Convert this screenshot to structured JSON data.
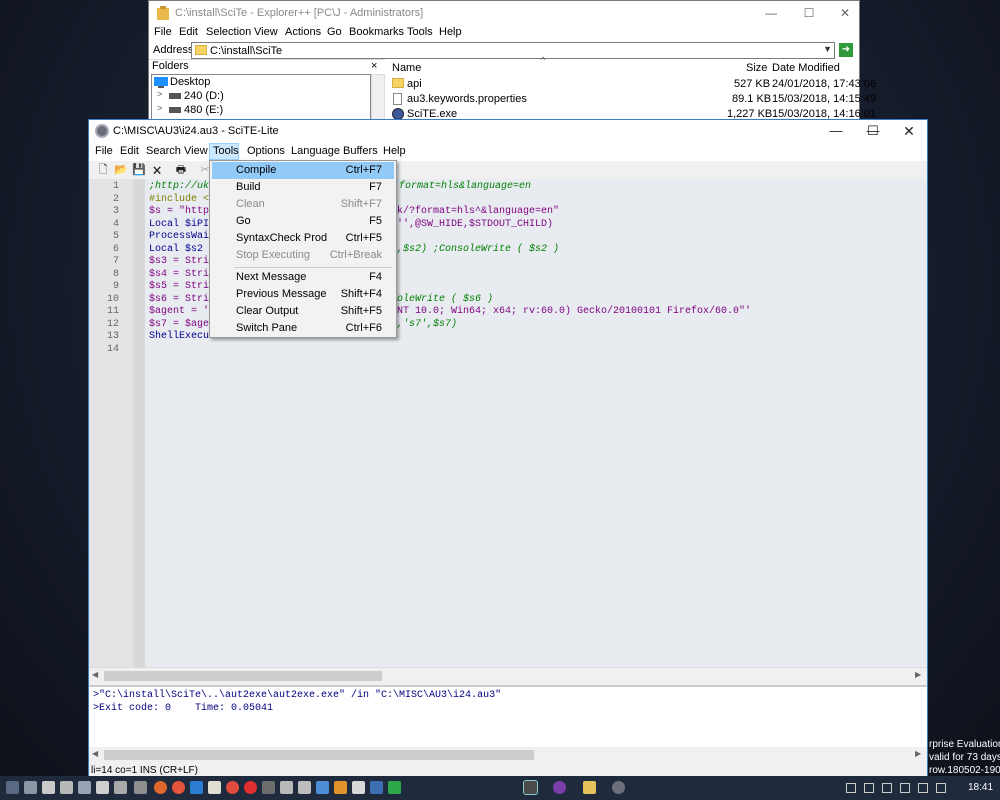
{
  "explorer": {
    "title": "C:\\install\\SciTe - Explorer++ [PC\\J - Administrators]",
    "menu": [
      "File",
      "Edit",
      "Selection",
      "View",
      "Actions",
      "Go",
      "Bookmarks",
      "Tools",
      "Help"
    ],
    "address_label": "Address",
    "address_value": "C:\\install\\SciTe",
    "folders_header": "Folders",
    "folders_close": "×",
    "tree": [
      {
        "label": "Desktop"
      },
      {
        "label": "240 (D:)"
      },
      {
        "label": "480 (E:)"
      }
    ],
    "columns": {
      "name": "Name",
      "size": "Size",
      "date": "Date Modified"
    },
    "files": [
      {
        "name": "api",
        "size": "527 KB",
        "date": "24/01/2018, 17:43:06",
        "icon": "folder-icon"
      },
      {
        "name": "au3.keywords.properties",
        "size": "89.1 KB",
        "date": "15/03/2018, 14:15:49",
        "icon": "document-icon"
      },
      {
        "name": "SciTE.exe",
        "size": "1,227 KB",
        "date": "15/03/2018, 14:16:01",
        "icon": "scite-app-icon"
      }
    ]
  },
  "scite": {
    "title": "C:\\MISC\\AU3\\i24.au3 - SciTE-Lite",
    "menu": [
      "File",
      "Edit",
      "Search",
      "View",
      "Tools",
      "Options",
      "Language",
      "Buffers",
      "Help"
    ],
    "line_numbers": [
      "1",
      "2",
      "3",
      "4",
      "5",
      "6",
      "7",
      "8",
      "9",
      "10",
      "11",
      "12",
      "13",
      "14"
    ],
    "code_lines": [
      {
        "a": ";http://uk.",
        "b": "format=hls&language=en"
      },
      {
        "a": "#include <A",
        "b": ""
      },
      {
        "a": "$s = \"http:",
        "b": "uk/?format=hls^&language=en\""
      },
      {
        "a": "Local $iPID",
        "b": " '',@SW_HIDE,$STDOUT_CHILD)"
      },
      {
        "a": "ProcessWait",
        "b": ""
      },
      {
        "a": "Local $s2 =",
        "b": "',$s2) ;ConsoleWrite ( $s2 )"
      },
      {
        "a": "$s3 = Strin",
        "b": ""
      },
      {
        "a": "$s4 = Strin",
        "b": ""
      },
      {
        "a": "$s5 = Strin",
        "b": ""
      },
      {
        "a": "$s6 = Strin",
        "b": "oleWrite ( $s6 )"
      },
      {
        "a": "$agent = '-",
        "b": "NT 10.0; Win64; x64; rv:60.0) Gecko/20100101 Firefox/60.0\"'"
      },
      {
        "a": "$s7 = $agen",
        "b": ",'s7',$s7)"
      },
      {
        "a": "ShellExecut",
        "b": ""
      },
      {
        "a": "",
        "b": ""
      }
    ],
    "output": [
      ">\"C:\\install\\SciTe\\..\\aut2exe\\aut2exe.exe\" /in \"C:\\MISC\\AU3\\i24.au3\"",
      ">Exit code: 0    Time: 0.05041"
    ],
    "status": "li=14 co=1 INS (CR+LF)"
  },
  "tools_menu": {
    "items": [
      {
        "label": "Compile",
        "shortcut": "Ctrl+F7",
        "state": "highlighted"
      },
      {
        "label": "Build",
        "shortcut": "F7",
        "state": "enabled"
      },
      {
        "label": "Clean",
        "shortcut": "Shift+F7",
        "state": "disabled"
      },
      {
        "label": "Go",
        "shortcut": "F5",
        "state": "enabled"
      },
      {
        "label": "SyntaxCheck Prod",
        "shortcut": "Ctrl+F5",
        "state": "enabled"
      },
      {
        "label": "Stop Executing",
        "shortcut": "Ctrl+Break",
        "state": "disabled"
      },
      {
        "label": "Next Message",
        "shortcut": "F4",
        "state": "enabled"
      },
      {
        "label": "Previous Message",
        "shortcut": "Shift+F4",
        "state": "enabled"
      },
      {
        "label": "Clear Output",
        "shortcut": "Shift+F5",
        "state": "enabled"
      },
      {
        "label": "Switch Pane",
        "shortcut": "Ctrl+F6",
        "state": "enabled"
      }
    ]
  },
  "watermark": [
    "rprise Evaluation",
    "valid for 73 days",
    "row.180502-1908"
  ],
  "taskbar": {
    "time": "18:41"
  },
  "colors": {
    "accent": "#3d7bc4",
    "menu_highlight": "#91c9f7",
    "taskbar": "#1f2b3c"
  }
}
